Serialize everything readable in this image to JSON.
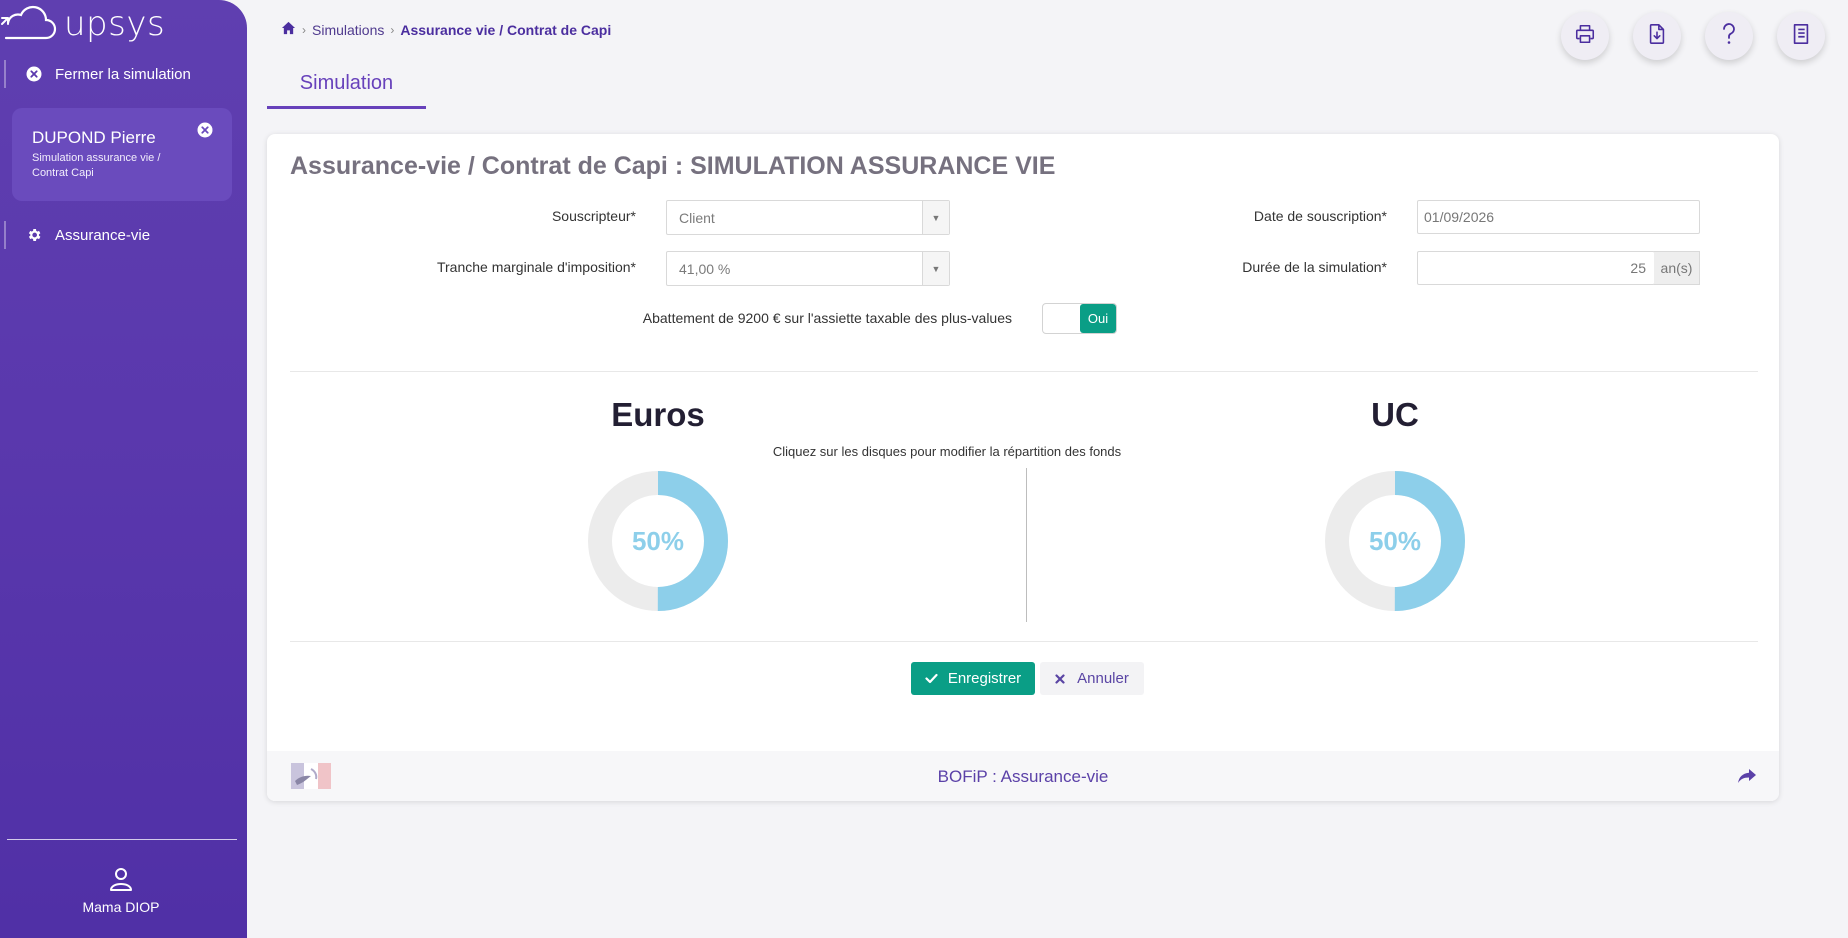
{
  "brand": {
    "name": "upsys"
  },
  "sidebar": {
    "close_simulation": "Fermer la simulation",
    "client": {
      "name": "DUPOND Pierre",
      "subtitle": "Simulation assurance vie / Contrat Capi"
    },
    "module": "Assurance-vie",
    "user": "Mama DIOP"
  },
  "breadcrumb": {
    "items": [
      "Simulations",
      "Assurance vie / Contrat de Capi"
    ]
  },
  "toolbar": {
    "icons": [
      "print-icon",
      "download-icon",
      "help-icon",
      "notebook-icon"
    ]
  },
  "tab": {
    "label": "Simulation"
  },
  "form": {
    "title": "Assurance-vie / Contrat de Capi : SIMULATION ASSURANCE VIE",
    "souscripteur": {
      "label": "Souscripteur*",
      "value": "Client"
    },
    "tmi": {
      "label": "Tranche marginale d'imposition*",
      "value": "41,00 %"
    },
    "date": {
      "label": "Date de souscription*",
      "value": "01/09/2026"
    },
    "duree": {
      "label": "Durée de la simulation*",
      "value": "25",
      "unit": "an(s)"
    },
    "abattement": {
      "label": "Abattement de 9200 € sur l'assiette taxable des plus-values",
      "toggle": "Oui"
    }
  },
  "allocation": {
    "instructions": "Cliquez sur les disques pour modifier la répartition des fonds",
    "euros": {
      "title": "Euros",
      "percent": 50,
      "label": "50%"
    },
    "uc": {
      "title": "UC",
      "percent": 50,
      "label": "50%"
    }
  },
  "actions": {
    "save": "Enregistrer",
    "cancel": "Annuler"
  },
  "footer": {
    "title": "BOFiP : Assurance-vie"
  },
  "colors": {
    "sidebar": "#5a38ad",
    "accent": "#6741bb",
    "success": "#0a9e86",
    "donut_fill": "#8dcfea",
    "donut_track": "#ececec"
  }
}
